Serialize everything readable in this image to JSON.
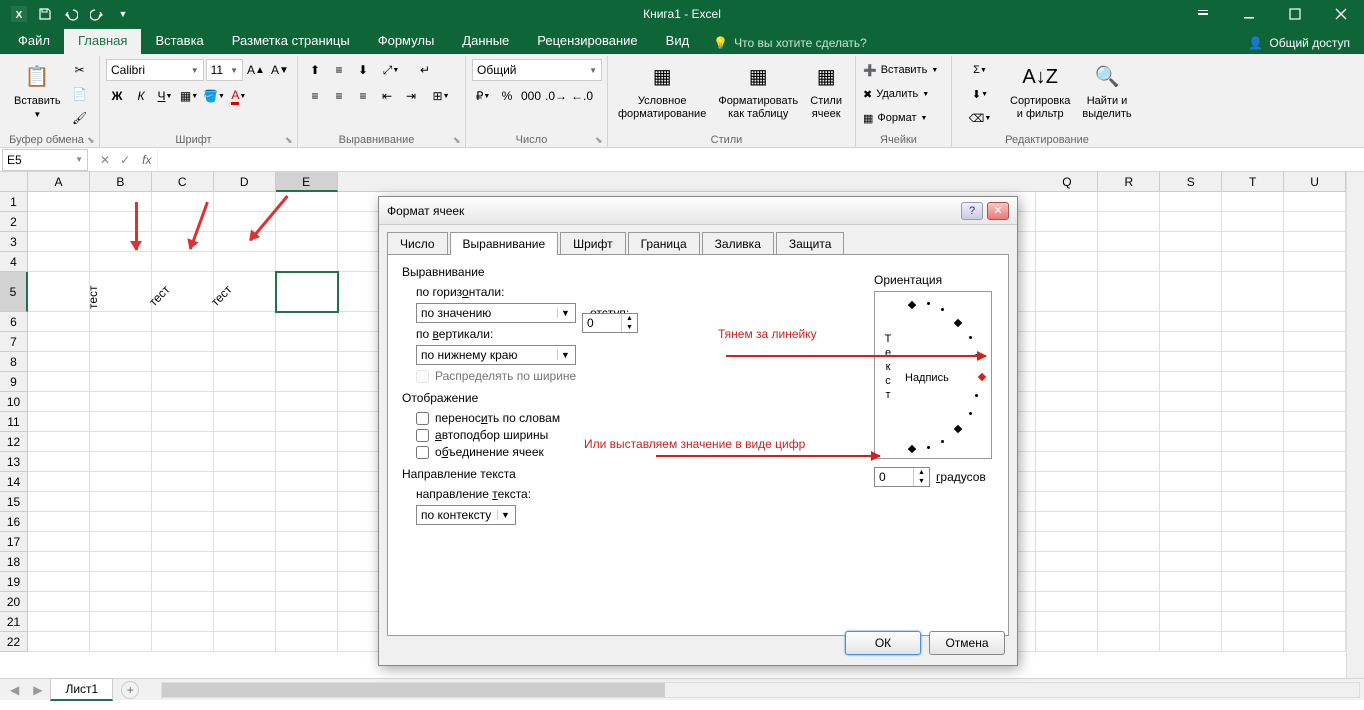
{
  "app": {
    "title": "Книга1 - Excel",
    "share": "Общий доступ"
  },
  "tabs": {
    "file": "Файл",
    "home": "Главная",
    "insert": "Вставка",
    "layout": "Разметка страницы",
    "formulas": "Формулы",
    "data": "Данные",
    "review": "Рецензирование",
    "view": "Вид",
    "tellme": "Что вы хотите сделать?"
  },
  "ribbon": {
    "clipboard": {
      "label": "Буфер обмена",
      "paste": "Вставить"
    },
    "font": {
      "label": "Шрифт",
      "family": "Calibri",
      "size": "11",
      "bold": "Ж",
      "italic": "К",
      "underline": "Ч"
    },
    "align": {
      "label": "Выравнивание"
    },
    "number": {
      "label": "Число",
      "format": "Общий"
    },
    "styles": {
      "label": "Стили",
      "cond": "Условное\nформатирование",
      "table": "Форматировать\nкак таблицу",
      "cell": "Стили\nячеек"
    },
    "cells": {
      "label": "Ячейки",
      "insert": "Вставить",
      "delete": "Удалить",
      "format": "Формат"
    },
    "editing": {
      "label": "Редактирование",
      "sort": "Сортировка\nи фильтр",
      "find": "Найти и\nвыделить"
    }
  },
  "namebox": "E5",
  "cells": {
    "b5": "тест",
    "c5": "тест",
    "d5": "тест"
  },
  "sheets": {
    "sheet1": "Лист1"
  },
  "dialog": {
    "title": "Формат ячеек",
    "tabs": {
      "number": "Число",
      "align": "Выравнивание",
      "font": "Шрифт",
      "border": "Граница",
      "fill": "Заливка",
      "protect": "Защита"
    },
    "alignment": "Выравнивание",
    "horiz_label": "по горизонтали:",
    "horiz_val": "по значению",
    "indent_label": "отступ:",
    "indent_val": "0",
    "vert_label": "по вертикали:",
    "vert_val": "по нижнему краю",
    "distribute": "Распределять по ширине",
    "display": "Отображение",
    "wrap": "переносить по словам",
    "autofit": "автоподбор ширины",
    "merge": "объединение ячеек",
    "direction": "Направление текста",
    "dir_label": "направление текста:",
    "dir_val": "по контексту",
    "orientation": "Ориентация",
    "orient_text": "Текст",
    "orient_label": "Надпись",
    "degrees": "0",
    "deg_label": "градусов",
    "ok": "ОК",
    "cancel": "Отмена",
    "note1": "Тянем за линейку",
    "note2": "Или выставляем значение в виде цифр"
  }
}
